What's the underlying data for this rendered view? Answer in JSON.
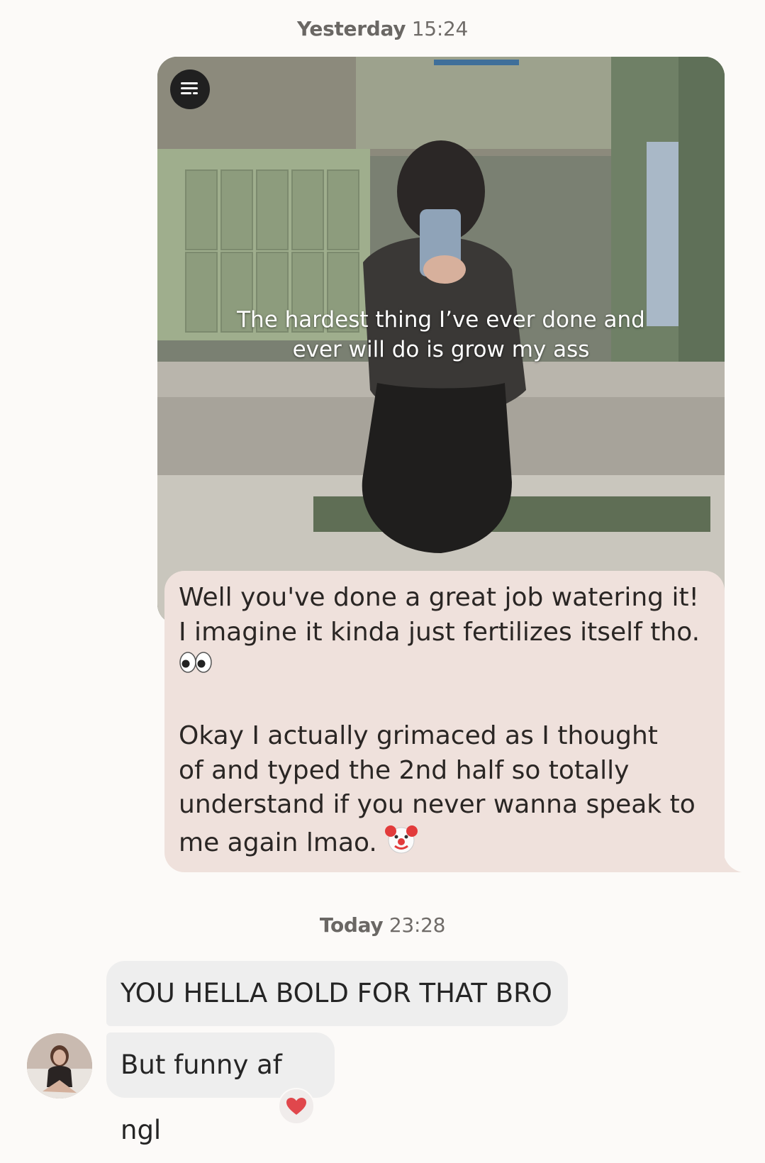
{
  "timestamps": [
    {
      "day": "Yesterday",
      "time": "15:24"
    },
    {
      "day": "Today",
      "time": "23:28"
    }
  ],
  "story": {
    "caption": "The hardest thing I’ve ever done and\never will do is grow my ass",
    "menu_icon": "story-menu-icon"
  },
  "reply": {
    "line1": "Well you've done a great job watering it!",
    "line2": "I imagine it kinda just fertilizes itself tho.",
    "emoji1": "eyes-emoji",
    "para2": "Okay I actually grimaced as I thought\nof and typed the 2nd half so totally\nunderstand if you never wanna speak to\nme again lmao.",
    "emoji2": "clown-emoji"
  },
  "incoming": [
    {
      "text": "YOU HELLA BOLD FOR THAT BRO"
    },
    {
      "text": "But funny af ngl"
    }
  ],
  "reaction": "heart-icon",
  "colors": {
    "background": "#fcfaf8",
    "outgoing_bubble": "#efe1dc",
    "incoming_bubble": "#eeeeee",
    "heart": "#e0474c"
  }
}
